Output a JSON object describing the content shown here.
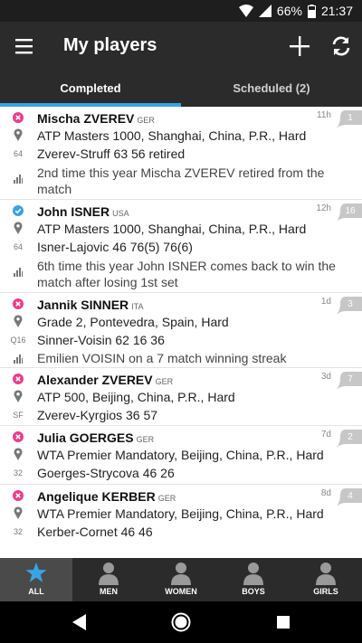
{
  "status": {
    "battery": "66%",
    "time": "21:37"
  },
  "appbar": {
    "title": "My players"
  },
  "tabs": [
    {
      "label": "Completed",
      "active": true
    },
    {
      "label": "Scheduled (2)",
      "active": false
    }
  ],
  "players": [
    {
      "name": "Mischa ZVEREV",
      "country": "GER",
      "status": "lost",
      "time": "11h",
      "count": "1",
      "tournament": "ATP Masters 1000, Shanghai, China, P.R., Hard",
      "round": "64",
      "result": "Zverev-Struff 63 56 retired",
      "stat": "2nd time this year Mischa ZVEREV retired from the match"
    },
    {
      "name": "John ISNER",
      "country": "USA",
      "status": "won",
      "time": "12h",
      "count": "16",
      "tournament": "ATP Masters 1000, Shanghai, China, P.R., Hard",
      "round": "64",
      "result": "Isner-Lajovic 46 76(5) 76(6)",
      "stat": "6th time this year John ISNER comes back to win the match after losing 1st set"
    },
    {
      "name": "Jannik SINNER",
      "country": "ITA",
      "status": "lost",
      "time": "1d",
      "count": "3",
      "tournament": "Grade 2, Pontevedra, Spain, Hard",
      "round": "Q16",
      "result": "Sinner-Voisin 62 16 36",
      "stat": "Emilien VOISIN on a 7 match winning streak"
    },
    {
      "name": "Alexander ZVEREV",
      "country": "GER",
      "status": "lost",
      "time": "3d",
      "count": "7",
      "tournament": "ATP 500, Beijing, China, P.R., Hard",
      "round": "SF",
      "result": "Zverev-Kyrgios 36 57"
    },
    {
      "name": "Julia GOERGES",
      "country": "GER",
      "status": "lost",
      "time": "7d",
      "count": "2",
      "tournament": "WTA Premier Mandatory, Beijing, China, P.R., Hard",
      "round": "32",
      "result": "Goerges-Strycova 46 26"
    },
    {
      "name": "Angelique KERBER",
      "country": "GER",
      "status": "lost",
      "time": "8d",
      "count": "4",
      "tournament": "WTA Premier Mandatory, Beijing, China, P.R., Hard",
      "round": "32",
      "result": "Kerber-Cornet 46 46"
    }
  ],
  "bottomnav": [
    {
      "label": "ALL",
      "icon": "star-icon",
      "active": true
    },
    {
      "label": "MEN",
      "icon": "person-icon",
      "active": false
    },
    {
      "label": "WOMEN",
      "icon": "person-icon",
      "active": false
    },
    {
      "label": "BOYS",
      "icon": "person-icon",
      "active": false
    },
    {
      "label": "GIRLS",
      "icon": "person-icon",
      "active": false
    }
  ],
  "colors": {
    "accent": "#3aa3e3",
    "lost": "#e83e8c",
    "won": "#3aa3e3",
    "bubble": "#c7c7c7"
  }
}
